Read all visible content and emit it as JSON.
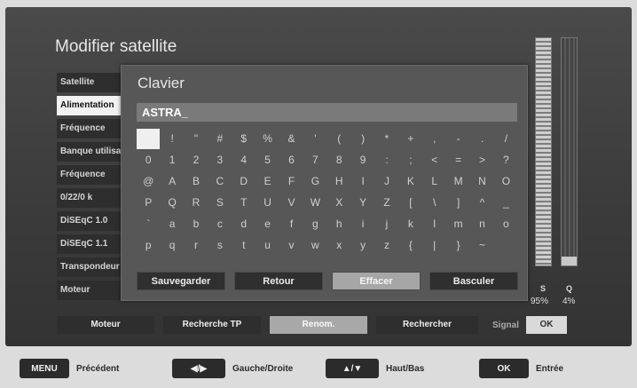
{
  "screen": {
    "title": "Modifier satellite"
  },
  "settings": {
    "items": [
      {
        "label": "Satellite"
      },
      {
        "label": "Alimentation"
      },
      {
        "label": "Fréquence"
      },
      {
        "label": "Banque utilisateur"
      },
      {
        "label": "Fréquence"
      },
      {
        "label": "0/22/0 k"
      },
      {
        "label": "DiSEqC 1.0"
      },
      {
        "label": "DiSEqC 1.1"
      },
      {
        "label": "Transpondeur"
      },
      {
        "label": "Moteur"
      }
    ]
  },
  "keyboard": {
    "title": "Clavier",
    "input_value": "ASTRA_",
    "rows": [
      [
        " ",
        "!",
        "\"",
        "#",
        "$",
        "%",
        "&",
        "'",
        "(",
        ")",
        "*",
        "+",
        ",",
        "-",
        ".",
        "/"
      ],
      [
        "0",
        "1",
        "2",
        "3",
        "4",
        "5",
        "6",
        "7",
        "8",
        "9",
        ":",
        ";",
        "<",
        "=",
        ">",
        "?"
      ],
      [
        "@",
        "A",
        "B",
        "C",
        "D",
        "E",
        "F",
        "G",
        "H",
        "I",
        "J",
        "K",
        "L",
        "M",
        "N",
        "O"
      ],
      [
        "P",
        "Q",
        "R",
        "S",
        "T",
        "U",
        "V",
        "W",
        "X",
        "Y",
        "Z",
        "[",
        "\\",
        "]",
        "^",
        "_"
      ],
      [
        "`",
        "a",
        "b",
        "c",
        "d",
        "e",
        "f",
        "g",
        "h",
        "i",
        "j",
        "k",
        "l",
        "m",
        "n",
        "o"
      ],
      [
        "p",
        "q",
        "r",
        "s",
        "t",
        "u",
        "v",
        "w",
        "x",
        "y",
        "z",
        "{",
        "|",
        "}",
        "~",
        " "
      ]
    ],
    "actions": {
      "save": "Sauvegarder",
      "back": "Retour",
      "erase": "Effacer",
      "toggle": "Basculer"
    }
  },
  "meters": {
    "s_label": "S",
    "q_label": "Q",
    "s_value": "95%",
    "q_value": "4%",
    "s_fraction": 0.95,
    "q_fraction": 0.04
  },
  "bottom_bar": {
    "motor": "Moteur",
    "search_tp": "Recherche TP",
    "rename": "Renom.",
    "search": "Rechercher",
    "signal": "Signal",
    "ok": "OK"
  },
  "legend": {
    "menu_key": "MENU",
    "menu_label": "Précédent",
    "lr_key": "◀/▶",
    "lr_label": "Gauche/Droite",
    "ud_key": "▲/▼",
    "ud_label": "Haut/Bas",
    "ok_key": "OK",
    "ok_label": "Entrée"
  }
}
